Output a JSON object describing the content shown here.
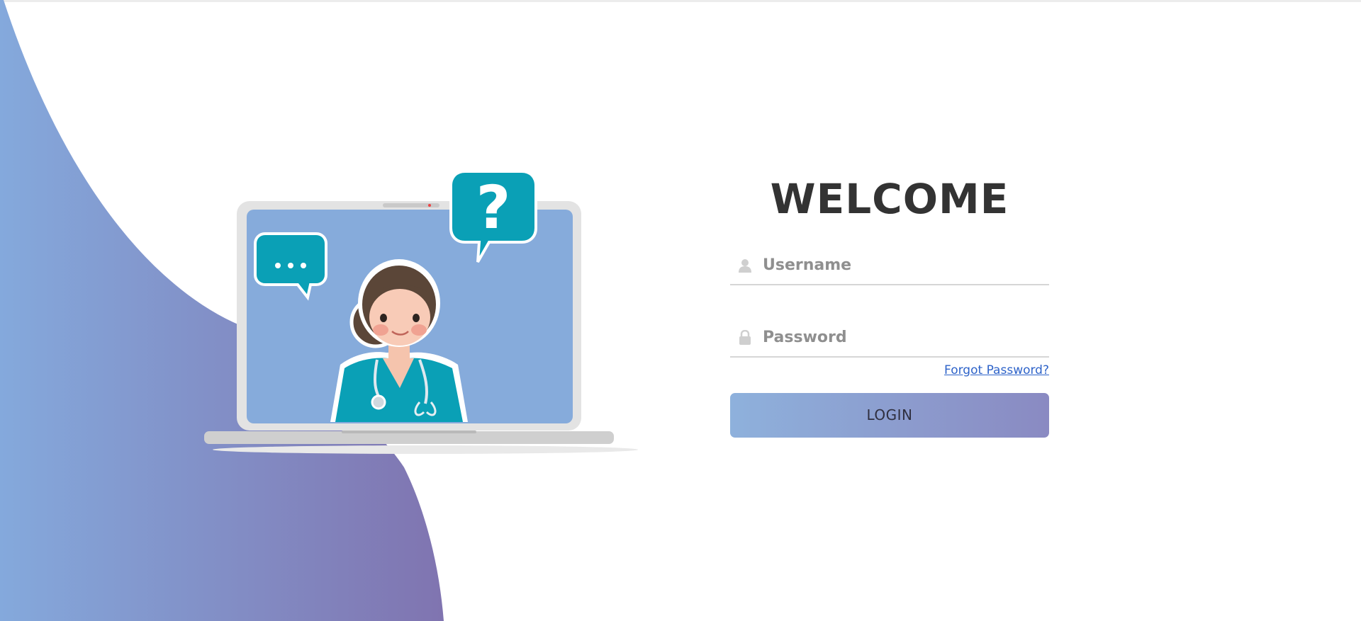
{
  "colors": {
    "wave_gradient_start": "#84a9dc",
    "wave_gradient_end": "#8074b0",
    "button_gradient_start": "#8eb1dc",
    "button_gradient_end": "#8a8ac2",
    "link": "#2e63c9",
    "chat_bubble": "#0aa0b6"
  },
  "login": {
    "title": "WELCOME",
    "username_placeholder": "Username",
    "password_placeholder": "Password",
    "username_icon": "user-icon",
    "password_icon": "lock-icon",
    "forgot_label": "Forgot Password?",
    "login_label": "LOGIN"
  },
  "illustration": {
    "subject": "doctor-on-laptop",
    "bubble_left_icon": "ellipsis-icon",
    "bubble_right_icon": "question-mark-icon"
  }
}
